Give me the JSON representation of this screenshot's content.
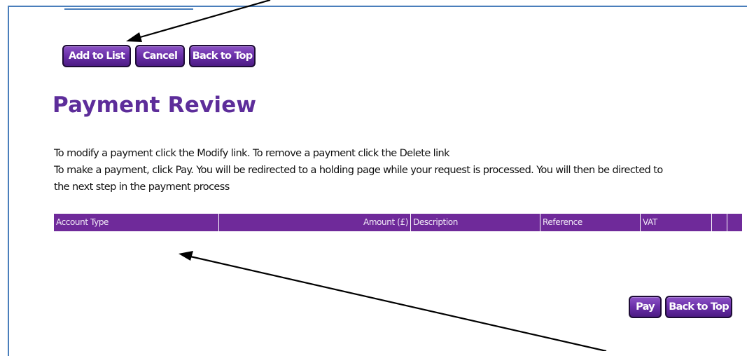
{
  "toolbar_top": {
    "add_to_list_label": "Add to List",
    "cancel_label": "Cancel",
    "back_to_top_label": "Back to Top"
  },
  "page": {
    "title": "Payment Review",
    "instruction_line1": "To modify a payment click the Modify link. To remove a payment click the Delete link",
    "instruction_line2": "To make a payment, click Pay. You will be redirected to a holding page while your request is processed. You will then be directed to",
    "instruction_line3": "the next step in the payment process"
  },
  "table": {
    "columns": [
      "Account Type",
      "Amount (£)",
      "Description",
      "Reference",
      "VAT",
      "",
      ""
    ],
    "rows": []
  },
  "toolbar_bottom": {
    "pay_label": "Pay",
    "back_to_top_label": "Back to Top"
  },
  "colors": {
    "accent": "#6a2fa8",
    "title": "#5d2d9a",
    "table_header": "#6f2a9a",
    "frame": "#4a7ebb"
  }
}
